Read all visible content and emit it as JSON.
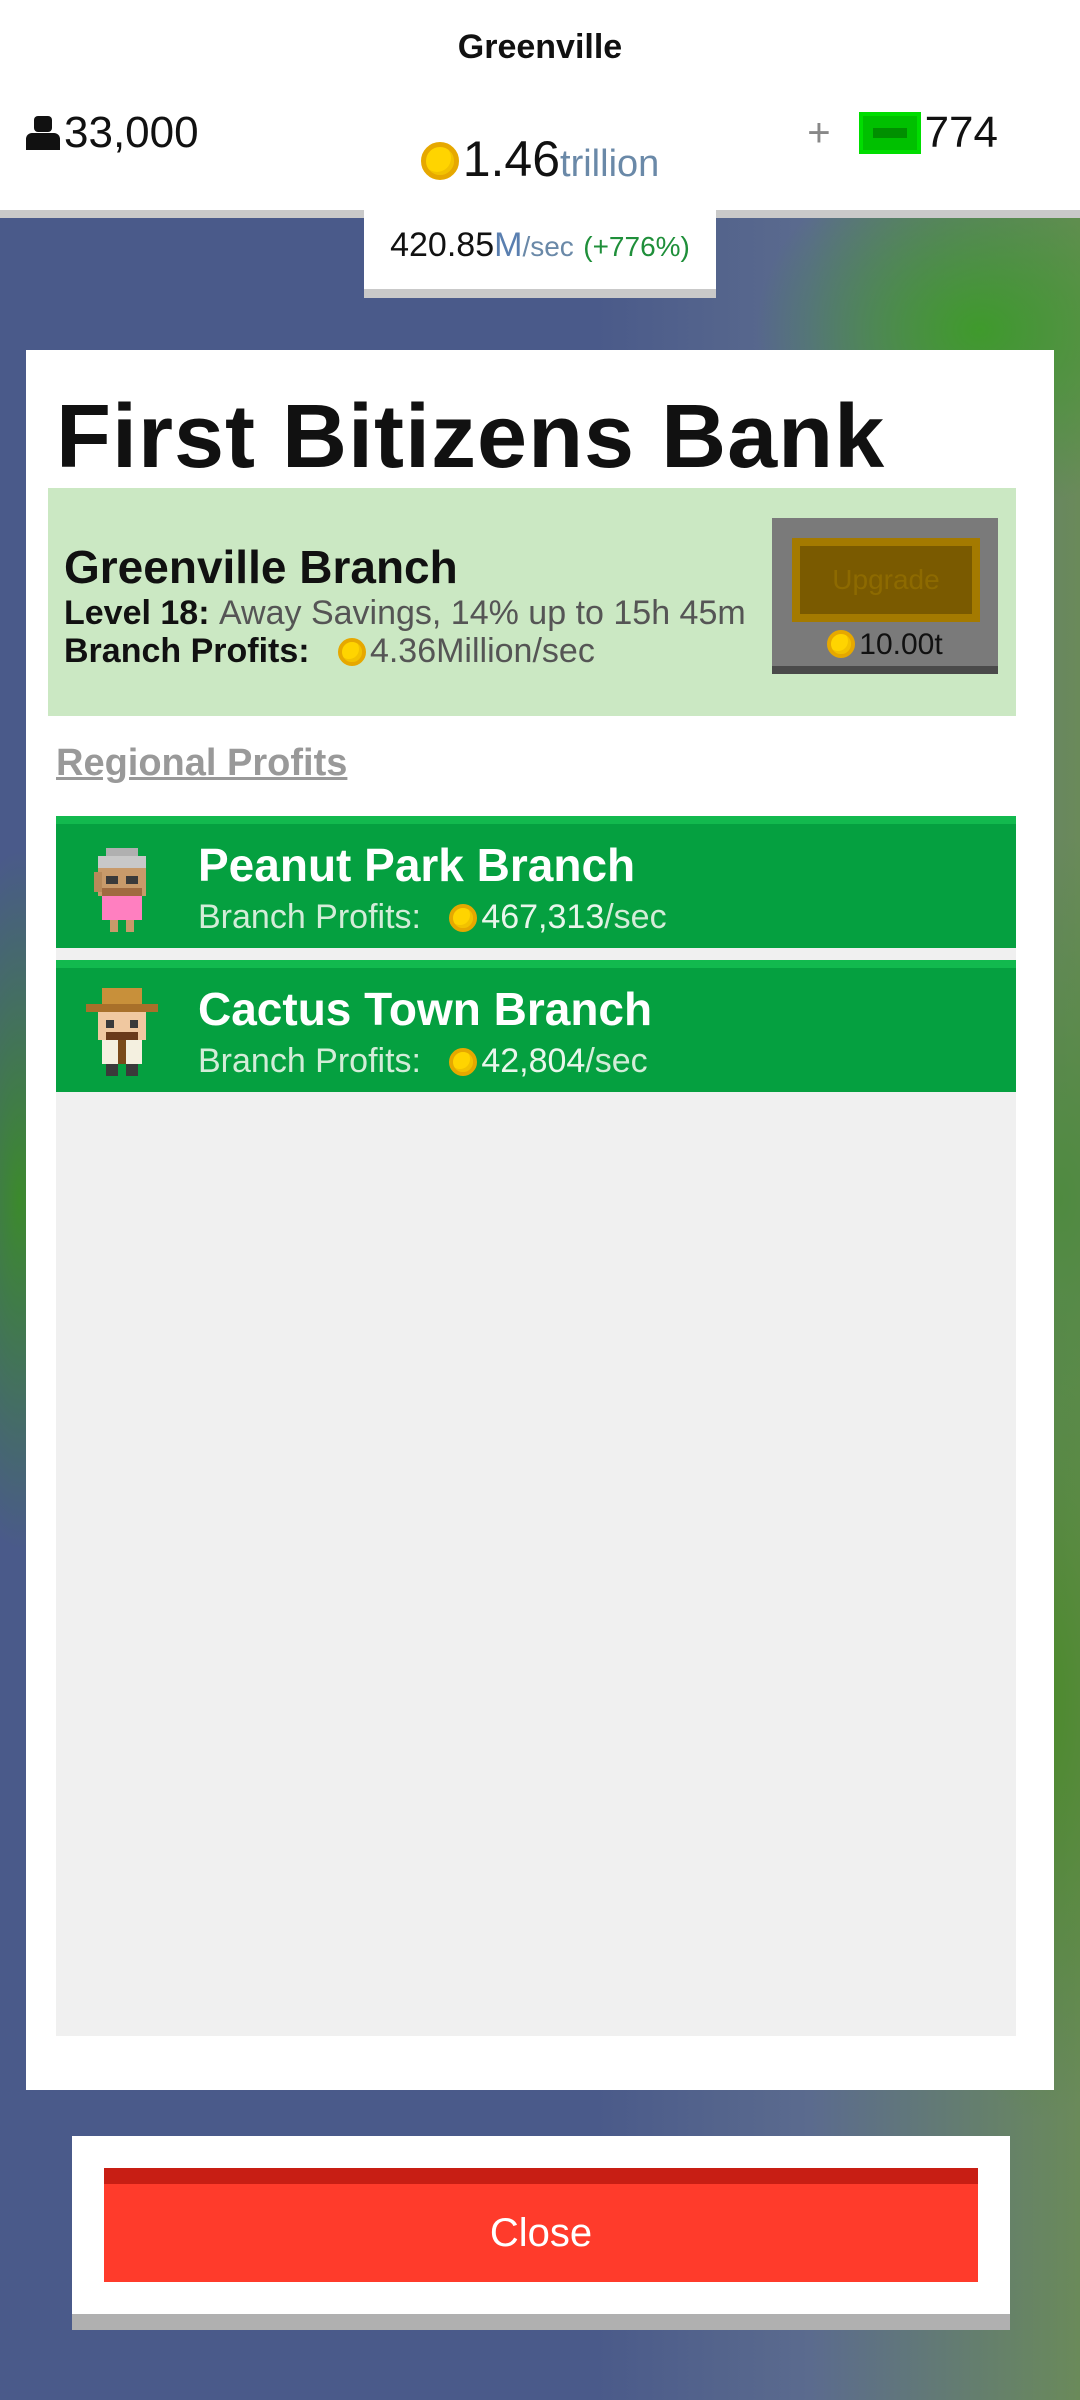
{
  "topbar": {
    "city": "Greenville",
    "population": "33,000",
    "coins_value": "1.46",
    "coins_unit": "trillion",
    "gems_plus": "+",
    "gems": "774",
    "rate_value": "420.85",
    "rate_suffix": "M",
    "rate_unit": "/sec",
    "rate_change": "(+776%)"
  },
  "panel": {
    "title": "First Bitizens Bank",
    "home_branch": {
      "name": "Greenville Branch",
      "level_label": "Level 18:",
      "level_desc": "Away Savings, 14% up to 15h 45m",
      "profit_label": "Branch Profits:",
      "profit_value": "4.36Million/sec",
      "upgrade_label": "Upgrade",
      "upgrade_cost": "10.00t"
    },
    "regional_label": "Regional Profits",
    "branches": [
      {
        "name": "Peanut Park Branch",
        "profit_label": "Branch Profits:",
        "profit_value": "467,313",
        "profit_unit": "/sec"
      },
      {
        "name": "Cactus Town Branch",
        "profit_label": "Branch Profits:",
        "profit_value": "42,804",
        "profit_unit": "/sec"
      }
    ]
  },
  "close_label": "Close",
  "colors": {
    "background": "#4a5a8a",
    "branch_green": "#05a040",
    "home_branch_bg": "#cbe8c3",
    "close_red": "#ff3b2b",
    "coin_gold": "#ffd400"
  },
  "icons": [
    "person-icon",
    "coin-icon",
    "gem-icon",
    "avatar-grandma-icon",
    "avatar-cowboy-icon"
  ]
}
